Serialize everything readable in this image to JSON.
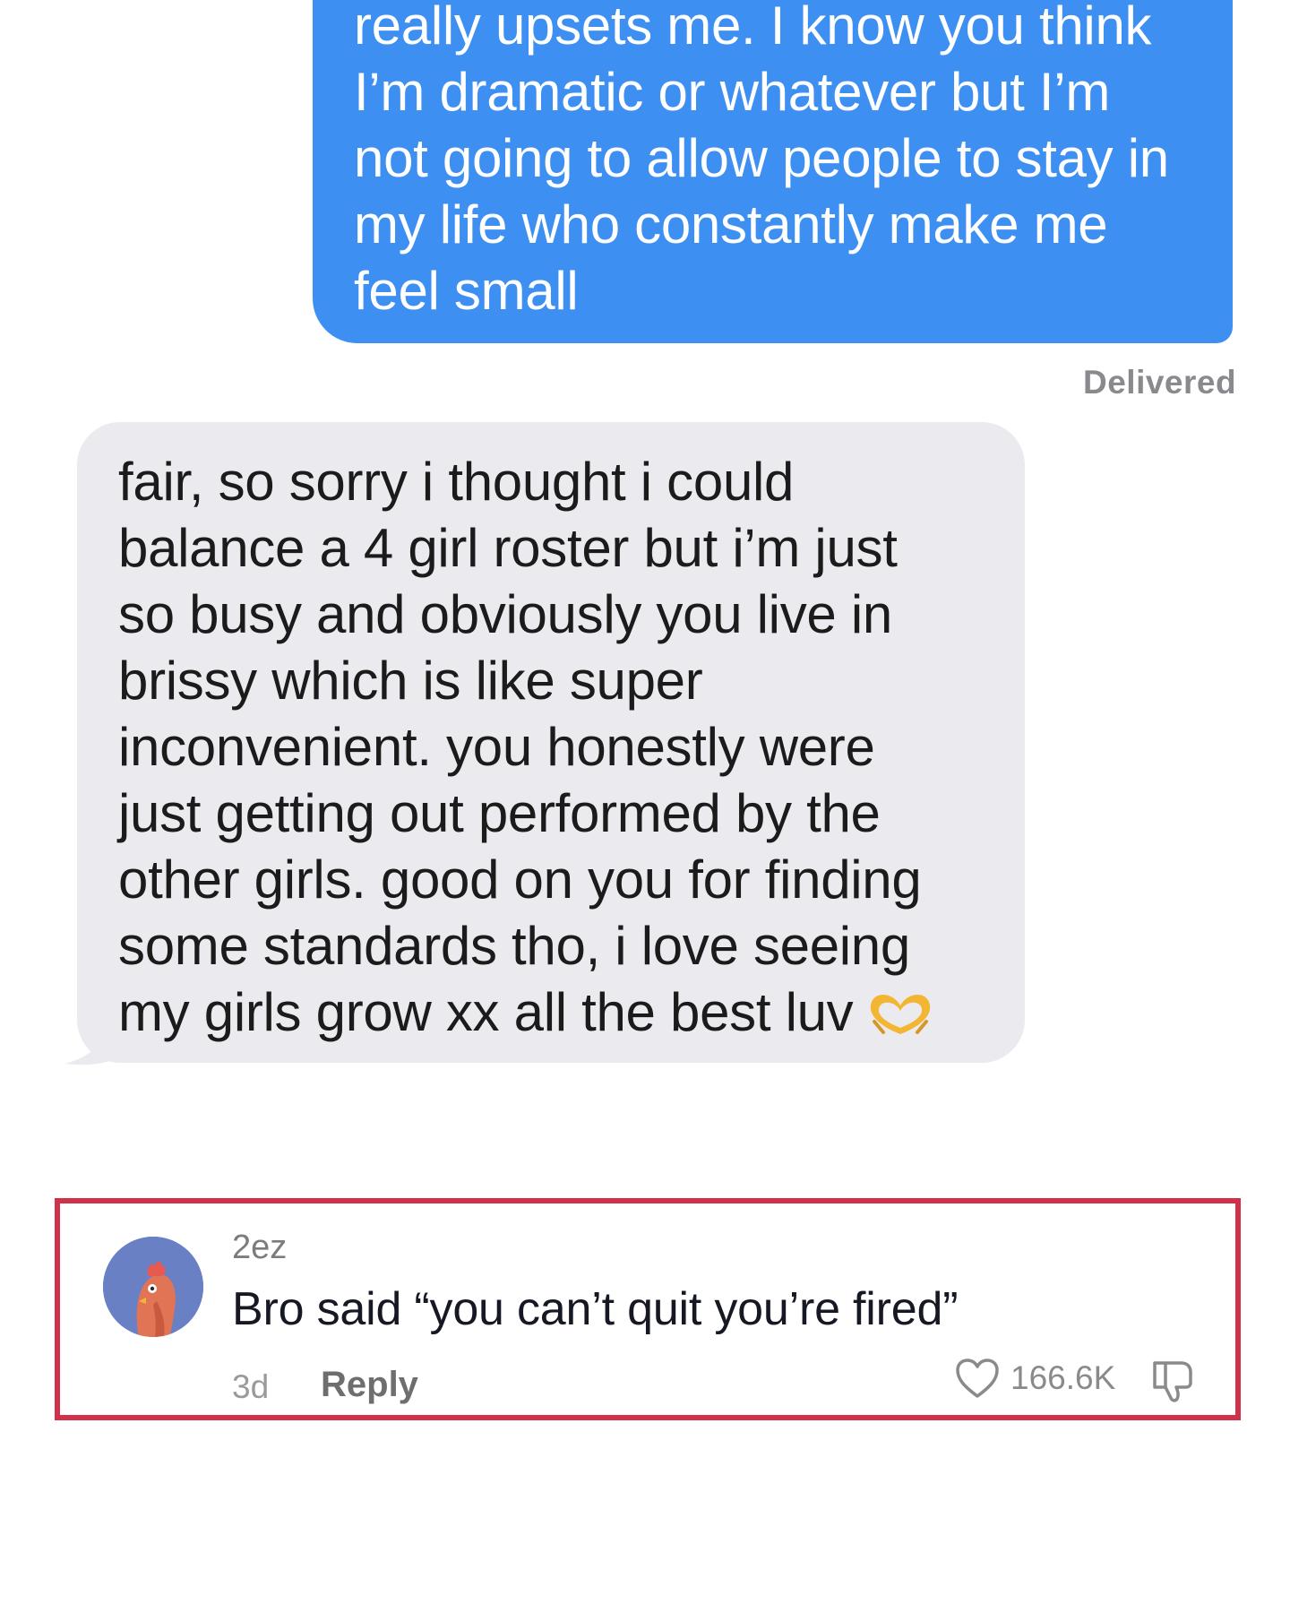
{
  "sent_message": {
    "text": "really upsets me. I know you think\nI’m dramatic or whatever but I’m\nnot going to allow people to stay in\nmy life who constantly make me\nfeel small",
    "status": "Delivered"
  },
  "received_message": {
    "text": "fair, so sorry i thought i could\nbalance a 4 girl roster but i’m just\nso busy and obviously you live in\nbrissy which is like super\ninconvenient. you honestly were\njust getting out performed by the\nother girls. good on you for finding\nsome standards tho, i love seeing\nmy girls grow xx all the best luv",
    "emoji": "heart-hands-emoji"
  },
  "comment": {
    "username": "2ez",
    "text": "Bro said “you can’t quit you’re fired”",
    "time": "3d",
    "reply_label": "Reply",
    "like_count": "166.6K",
    "avatar": "rooster-avatar-icon"
  },
  "colors": {
    "sent_bubble": "#3d8ff2",
    "received_bubble": "#ebebef",
    "highlight_border": "#d0304a"
  }
}
